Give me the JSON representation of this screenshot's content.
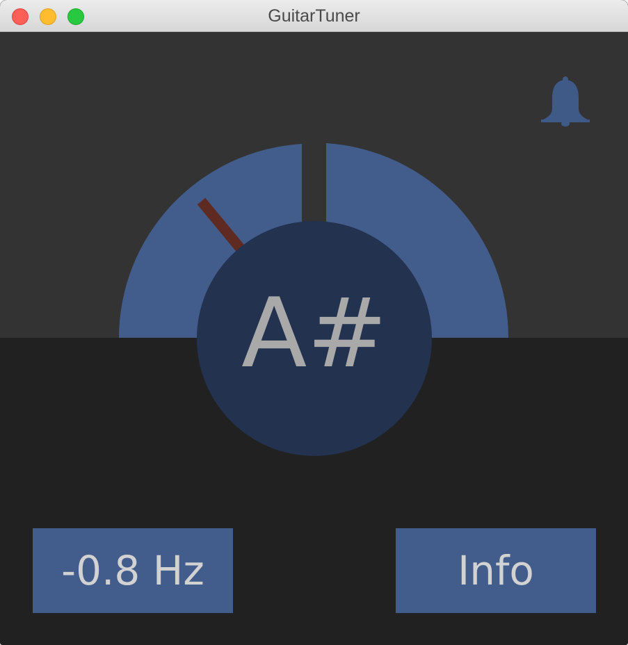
{
  "window": {
    "title": "GuitarTuner"
  },
  "tuner": {
    "note": "A#",
    "needle_offset_fraction": -0.44,
    "colors": {
      "gauge": "#425d8c",
      "note_circle": "#22324f",
      "needle": "#5e2a22",
      "upper_bg": "#333333",
      "lower_bg": "#212121"
    }
  },
  "controls": {
    "frequency_label": "-0.8 Hz",
    "info_label": "Info",
    "alert_icon": "bell-icon"
  }
}
